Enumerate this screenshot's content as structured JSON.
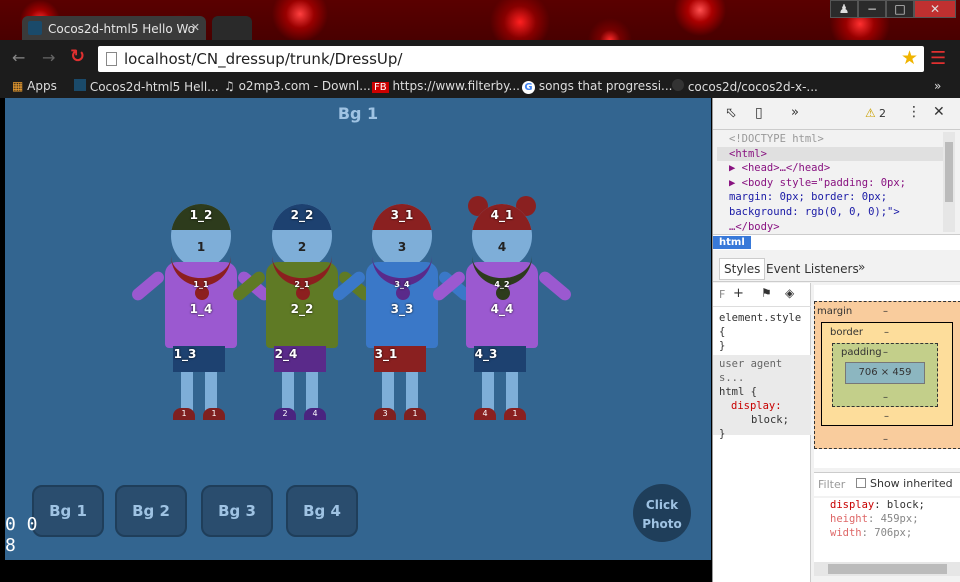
{
  "browser": {
    "tab_active_title": "Cocos2d-html5 Hello Wo",
    "tab_inactive_title": "",
    "url": "localhost/CN_dressup/trunk/DressUp/",
    "window_buttons": [
      "−",
      "□",
      "✕"
    ],
    "bookmarks": [
      {
        "label": "Apps",
        "icon": "apps-grid-icon"
      },
      {
        "label": "Cocos2d-html5 Hell...",
        "icon": "cocos-icon"
      },
      {
        "label": "o2mp3.com - Downl...",
        "icon": "headphones-icon"
      },
      {
        "label": "https://www.filterby...",
        "icon": "fb-icon"
      },
      {
        "label": "songs that progressi...",
        "icon": "google-icon"
      },
      {
        "label": "cocos2d/cocos2d-x-...",
        "icon": "github-icon"
      }
    ],
    "more": "»"
  },
  "game": {
    "title": "Bg 1",
    "fps": "0 0",
    "fps2": "8",
    "bg_buttons": [
      "Bg 1",
      "Bg 2",
      "Bg 3",
      "Bg 4"
    ],
    "photo_button": [
      "Click",
      "Photo"
    ],
    "characters": [
      {
        "hat": "1_2",
        "face": "1",
        "necklace": "1_1",
        "shirt": "1_4",
        "pants": "1_3",
        "shoe_l": "1",
        "shoe_r": "1",
        "hat_color": "#2d3b1c",
        "shirt_color": "#9b59d0",
        "pants_color": "#1d4170",
        "shoe_color": "#7f2020",
        "neck_color": "#8c1f1f",
        "style": "plain"
      },
      {
        "hat": "2_2",
        "face": "2",
        "necklace": "2_1",
        "shirt": "2_2",
        "pants": "2_4",
        "shoe_l": "2",
        "shoe_r": "4",
        "hat_color": "#1d4170",
        "shirt_color": "#5f7a25",
        "pants_color": "#5a2a8a",
        "shoe_color": "#4a2480",
        "neck_color": "#8c1f1f",
        "style": "plain"
      },
      {
        "hat": "3_1",
        "face": "3",
        "necklace": "3_4",
        "shirt": "3_3",
        "pants": "3_1",
        "shoe_l": "3",
        "shoe_r": "1",
        "hat_color": "#8a2020",
        "shirt_color": "#3a78c8",
        "pants_color": "#8a2020",
        "shoe_color": "#7f2020",
        "neck_color": "#5a2a8a",
        "style": "plain"
      },
      {
        "hat": "4_1",
        "face": "4",
        "necklace": "4_2",
        "shirt": "4_4",
        "pants": "4_3",
        "shoe_l": "4",
        "shoe_r": "1",
        "hat_color": "#8a2020",
        "shirt_color": "#9b59d0",
        "pants_color": "#1d4170",
        "shoe_color": "#8a2020",
        "neck_color": "#2d3b1c",
        "style": "ears"
      }
    ]
  },
  "devtools": {
    "warning_count": "2",
    "dom_lines": [
      "<!DOCTYPE html>",
      "<html>",
      "▶ <head>…</head>",
      "▶ <body style=\"padding: 0px;",
      "margin: 0px; border: 0px;",
      "background: rgb(0, 0, 0);\">",
      "…</body>"
    ],
    "breadcrumb": "html",
    "tabs": [
      "Styles",
      "Event Listeners",
      "»"
    ],
    "styles_filter": "F",
    "rule1": [
      "element.style",
      "{",
      "}"
    ],
    "rule2_header": "user agent s...",
    "rule2": [
      "html {",
      "display:",
      "block;",
      "}"
    ],
    "box_labels": {
      "margin": "margin",
      "border": "border",
      "padding": "padding",
      "dash": "–",
      "content": "706 × 459"
    },
    "filter_placeholder": "Filter",
    "show_inherited": "Show inherited",
    "computed": [
      {
        "prop": "display",
        "value": "block;"
      },
      {
        "prop": "height",
        "value": "459px;"
      },
      {
        "prop": "width",
        "value": "706px;"
      }
    ]
  }
}
